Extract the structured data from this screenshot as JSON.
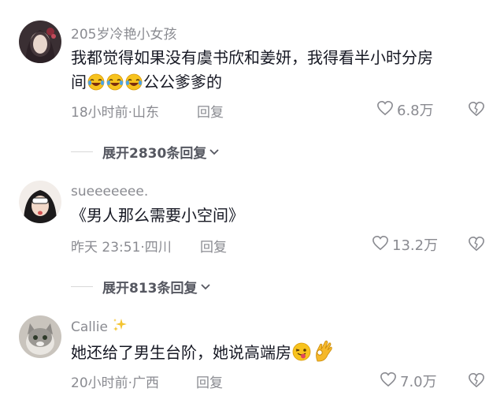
{
  "comments": [
    {
      "username": "205岁冷艳小女孩",
      "content_line1": "我都觉得如果没有虞书欣和姜妍，我得看半小时分房",
      "content_line2_prefix": "间",
      "content_line2_suffix": "公公爹爹的",
      "emojis": [
        "laughing-crying-emoji",
        "laughing-crying-emoji",
        "laughing-crying-emoji"
      ],
      "time_location": "18小时前·山东",
      "reply_label": "回复",
      "likes": "6.8万",
      "expand_label": "展开2830条回复"
    },
    {
      "username": "sueeeeeee.",
      "content_line1": "《男人那么需要小空间》",
      "time_location": "昨天 23:51·四川",
      "reply_label": "回复",
      "likes": "13.2万",
      "expand_label": "展开813条回复"
    },
    {
      "username": "Callie",
      "username_icon": "sparkles-emoji",
      "content_prefix": "她还给了男生台阶，她说高端房",
      "emojis": [
        "winking-tongue-emoji",
        "ok-hand-emoji"
      ],
      "time_location": "20小时前·广西",
      "reply_label": "回复",
      "likes": "7.0万"
    }
  ],
  "colors": {
    "text": "#161823",
    "muted": "#8a8b91",
    "expand": "#555760"
  }
}
